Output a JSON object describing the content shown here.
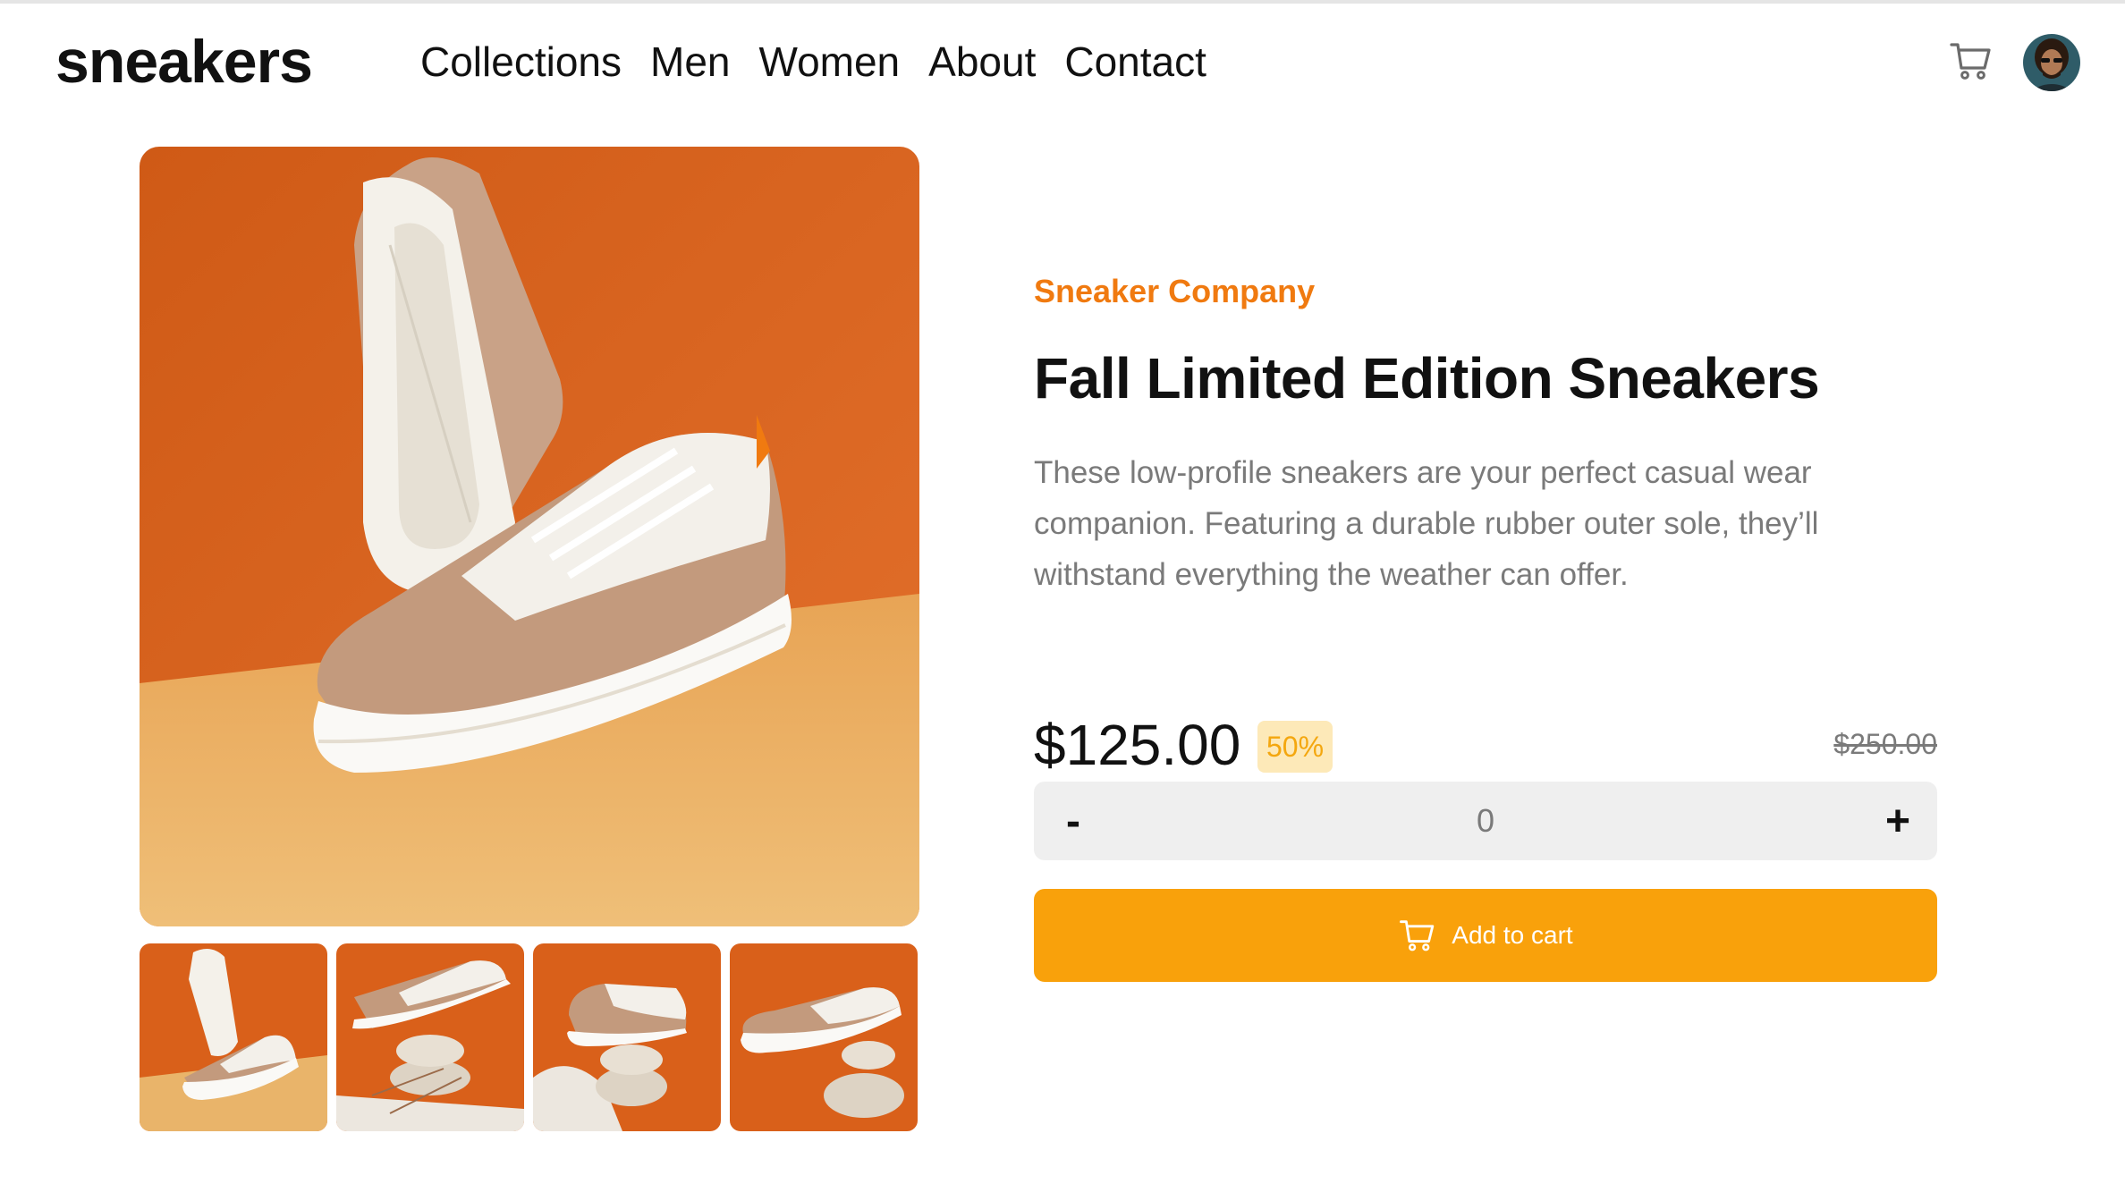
{
  "header": {
    "logo": "sneakers",
    "nav": [
      "Collections",
      "Men",
      "Women",
      "About",
      "Contact"
    ]
  },
  "product": {
    "brand": "Sneaker Company",
    "title": "Fall Limited Edition Sneakers",
    "description": "These low-profile sneakers are your perfect casual wear companion. Featuring a durable rubber outer sole, they’ll withstand everything the weather can offer.",
    "price": "$125.00",
    "discount": "50%",
    "original_price": "$250.00",
    "quantity": "0",
    "minus_label": "-",
    "plus_label": "+",
    "add_to_cart": "Add to cart"
  },
  "icons": {
    "cart": "cart-icon",
    "avatar": "user-avatar"
  },
  "colors": {
    "brand_orange": "#f07a10",
    "cta": "#f9a10b",
    "discount_bg": "#fde9b8",
    "discount_text": "#f4a70f",
    "image_bg_top": "#d9601a",
    "image_bg_bottom": "#e9b46a"
  }
}
